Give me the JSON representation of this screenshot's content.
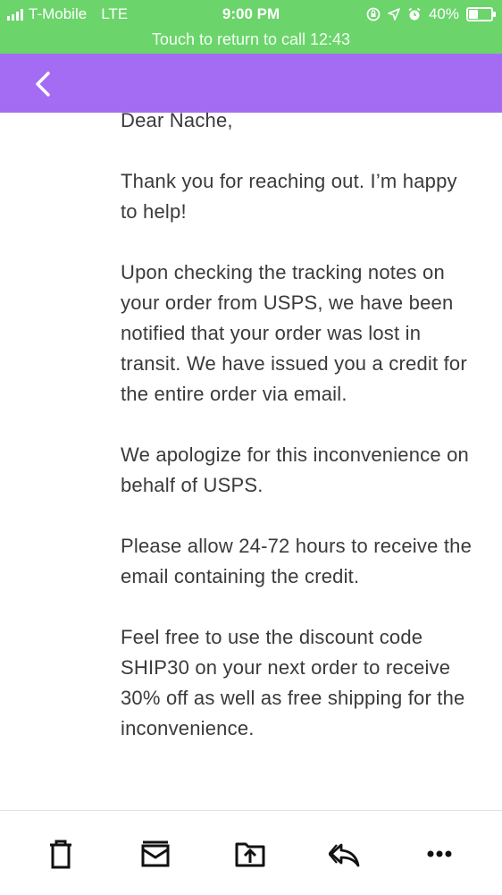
{
  "status_bar": {
    "carrier": "T-Mobile",
    "network": "LTE",
    "time": "9:00 PM",
    "battery": "40%",
    "battery_level": 0.4,
    "icons": [
      "signal-icon",
      "screen-lock-icon",
      "location-icon",
      "alarm-icon",
      "battery-icon"
    ]
  },
  "call_banner": {
    "text": "Touch to return to call 12:43"
  },
  "nav": {
    "back_icon": "back-chevron-icon",
    "color": "#a36cf3"
  },
  "message": {
    "paragraphs": [
      "Dear Nache,",
      "Thank you for reaching out. I’m happy to help!",
      "Upon checking the tracking notes on your order from USPS, we have been notified that your order was lost in transit. We have issued you a credit for the entire order via email.",
      "We apologize for this inconvenience on behalf of USPS.",
      "Please allow 24-72 hours to receive the email containing the credit.",
      "Feel free to use the discount code SHIP30 on your next order to receive 30% off as well as free shipping for the inconvenience."
    ]
  },
  "toolbar": {
    "icons": [
      "trash-icon",
      "archive-icon",
      "share-icon",
      "reply-icon",
      "more-icon"
    ]
  },
  "colors": {
    "status_green": "#6bd46b",
    "nav_purple": "#a36cf3",
    "text": "#3a3a3a"
  }
}
